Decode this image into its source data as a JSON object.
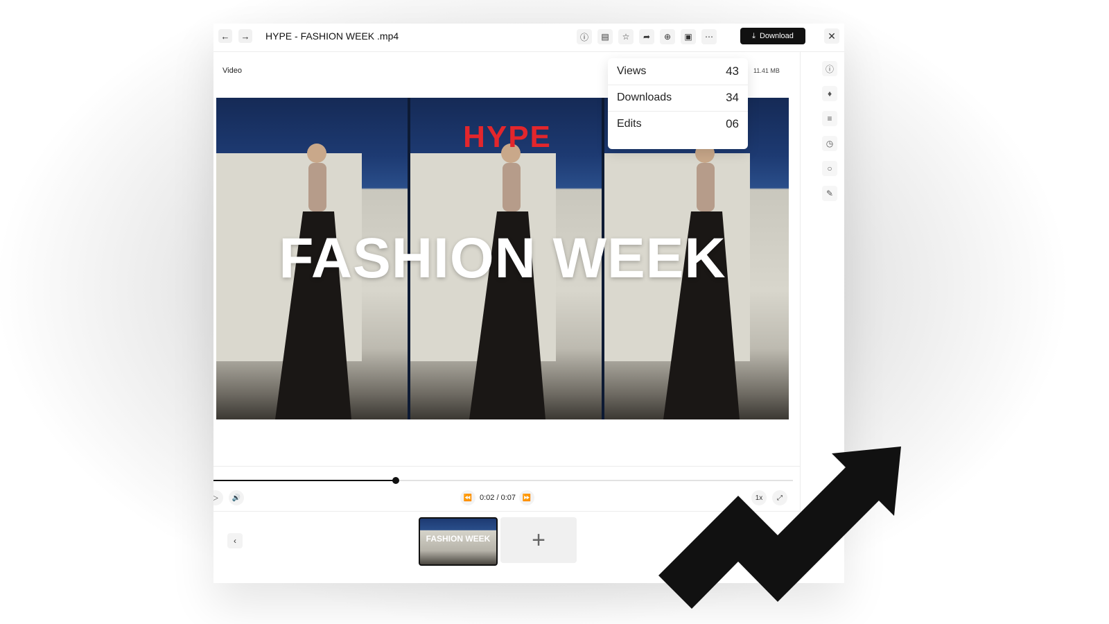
{
  "header": {
    "title": "HYPE - FASHION WEEK .mp4",
    "download_label": "Download"
  },
  "toolbar_icons": [
    "info-icon",
    "document-icon",
    "star-icon",
    "share-icon",
    "plus-circle-icon",
    "image-icon",
    "more-icon"
  ],
  "side_icons": [
    "info-icon",
    "tag-icon",
    "layers-icon",
    "history-icon",
    "comment-icon",
    "edit-icon"
  ],
  "asset": {
    "type_label": "Video",
    "size_label": "11.41 MB"
  },
  "video": {
    "logo_text": "HYPE",
    "headline": "FASHION WEEK"
  },
  "stats": [
    {
      "label": "Views",
      "value": "43"
    },
    {
      "label": "Downloads",
      "value": "34"
    },
    {
      "label": "Edits",
      "value": "06"
    }
  ],
  "player": {
    "time": "0:02 / 0:07",
    "speed": "1x",
    "progress": 0.315
  },
  "filmstrip": {
    "thumb_text": "FASHION WEEK",
    "add_label": "+"
  },
  "colors": {
    "accent": "#111111",
    "logo_red": "#e3262c"
  }
}
